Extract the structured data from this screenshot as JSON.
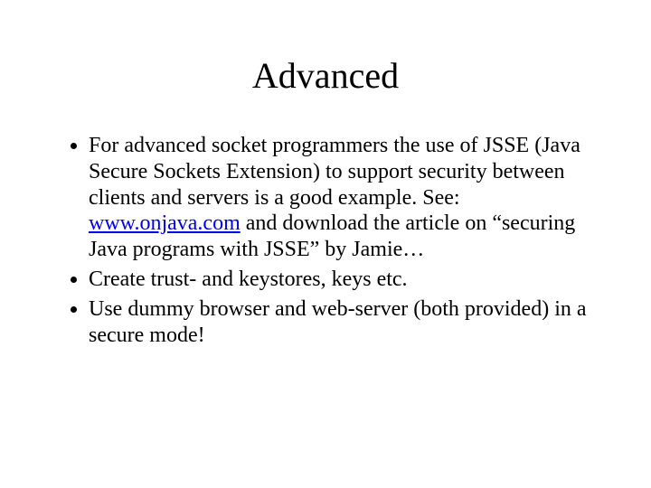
{
  "slide": {
    "title": "Advanced",
    "bullets": [
      {
        "pre": "For advanced socket programmers the use of JSSE (Java Secure Sockets Extension) to support security between clients and servers is a good example. See: ",
        "link": "www.onjava.com",
        "post": " and download the article on “securing Java programs with JSSE” by Jamie…"
      },
      {
        "pre": "Create trust- and keystores, keys etc.",
        "link": "",
        "post": ""
      },
      {
        "pre": "Use dummy browser and web-server (both provided) in a secure mode!",
        "link": "",
        "post": ""
      }
    ]
  }
}
